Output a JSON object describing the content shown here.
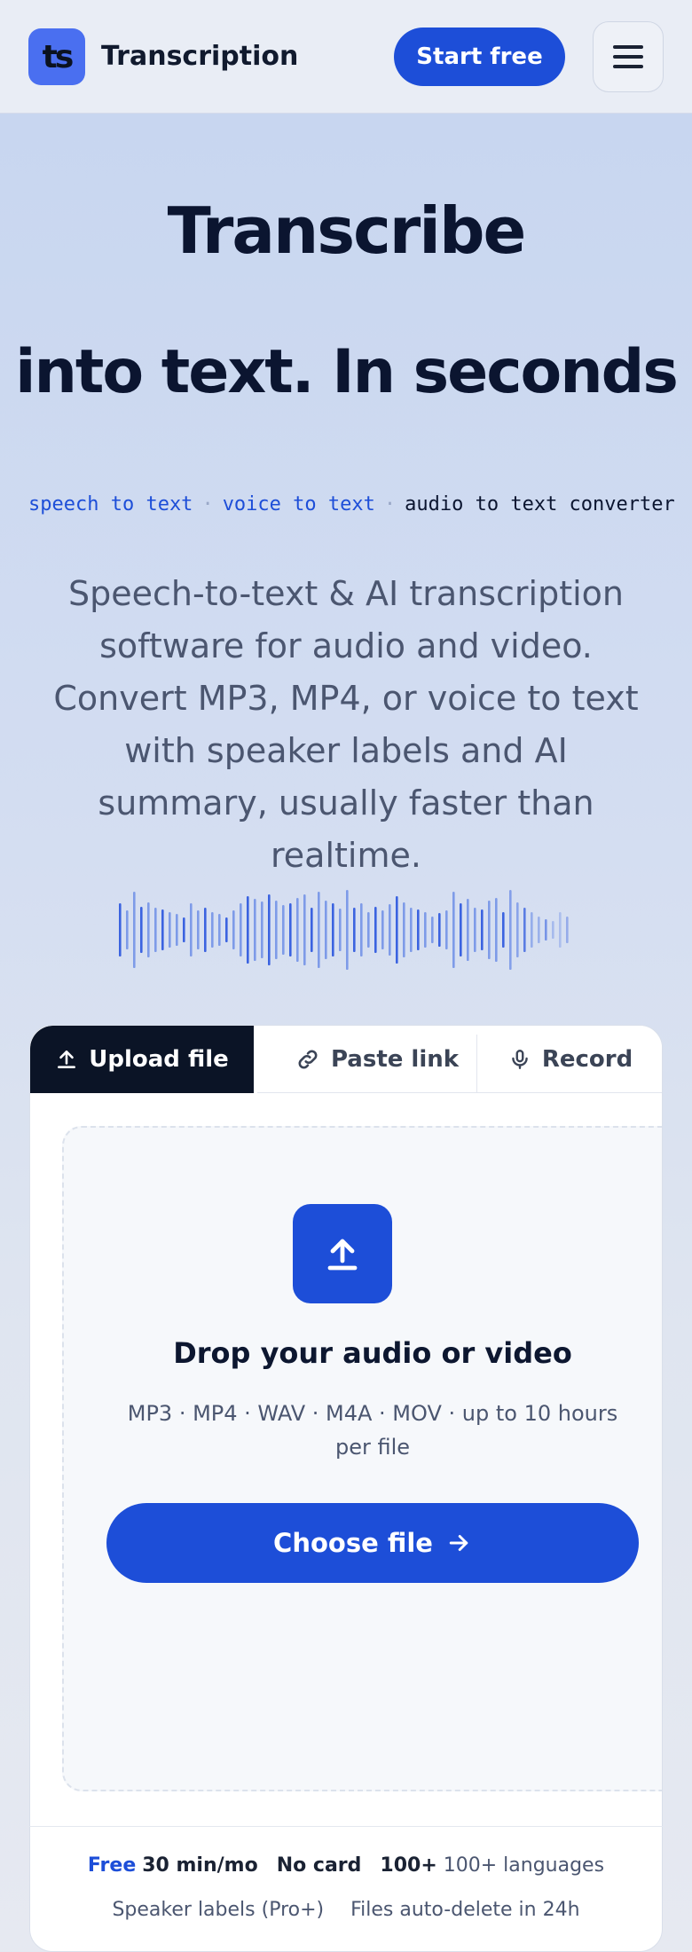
{
  "header": {
    "logo_text": "ts",
    "brand": "Transcription",
    "start_label": "Start free",
    "menu_icon": "hamburger-menu-icon"
  },
  "hero": {
    "title_line1": "Transcribe",
    "title_line2": "into text. In seconds",
    "keywords": [
      "speech to text",
      "voice to text",
      "audio to text converter"
    ],
    "keyword_separator": "·",
    "subtitle": "Speech-to-text & AI transcription software for audio and video. Convert MP3, MP4, or voice to text with speaker labels and AI summary, usually faster than realtime."
  },
  "card": {
    "tabs": [
      {
        "label": "Upload file",
        "icon": "upload-icon",
        "active": true
      },
      {
        "label": "Paste link",
        "icon": "link-icon",
        "active": false
      },
      {
        "label": "Record",
        "icon": "microphone-icon",
        "active": false
      }
    ],
    "dropzone": {
      "icon": "upload-arrow-icon",
      "title": "Drop your audio or video",
      "formats": "MP3 · MP4 · WAV · M4A · MOV · up to 10 hours per file",
      "button_label": "Choose file",
      "button_icon": "arrow-right-icon"
    },
    "meta": {
      "free_label": "Free",
      "free_value": "30 min/mo",
      "no_card": "No card",
      "languages_bold": "100+",
      "languages_text": "100+ languages",
      "speaker_labels": "Speaker labels (Pro+)",
      "auto_delete": "Files auto-delete in 24h"
    }
  },
  "colors": {
    "accent": "#1d4ed8",
    "dark": "#0b1426",
    "logo_bg": "#4a6ff0"
  }
}
